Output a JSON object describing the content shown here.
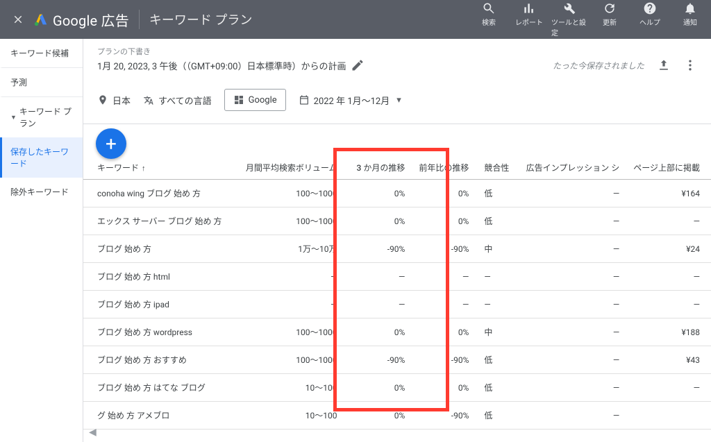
{
  "header": {
    "brand": "Google 広告",
    "page_title": "キーワード プラン",
    "tools": {
      "search": "検索",
      "reports": "レポート",
      "tools": "ツールと設定",
      "refresh": "更新",
      "help": "ヘルプ",
      "notif": "通知"
    }
  },
  "sidebar": {
    "ideas": "キーワード候補",
    "forecast": "予測",
    "plan": "キーワード プラン",
    "saved": "保存したキーワード",
    "negative": "除外キーワード"
  },
  "plan": {
    "draft_label": "プランの下書き",
    "date_line": "1月 20, 2023, 3 午後（（GMT+09:00）日本標準時）からの計画",
    "saved_msg": "たった今保存されました"
  },
  "filters": {
    "location": "日本",
    "language": "すべての言語",
    "network": "Google",
    "daterange": "2022 年 1月～12月"
  },
  "table": {
    "headers": {
      "keyword": "キーワード",
      "volume": "月間平均検索ボリューム",
      "trend3m": "3 か月の推移",
      "trendyoy": "前年比の推移",
      "competition": "競合性",
      "impression": "広告インプレッション シ",
      "topbid": "ページ上部に掲載"
    },
    "rows": [
      {
        "kw": "conoha wing ブログ 始め 方",
        "vol": "100～1000",
        "t3": "0%",
        "ty": "0%",
        "comp": "低",
        "imp": "—",
        "bid": "¥164"
      },
      {
        "kw": "エックス サーバー ブログ 始め 方",
        "vol": "100～1000",
        "t3": "0%",
        "ty": "0%",
        "comp": "低",
        "imp": "—",
        "bid": "—"
      },
      {
        "kw": "ブログ 始め 方",
        "vol": "1万～10万",
        "t3": "-90%",
        "ty": "-90%",
        "comp": "中",
        "imp": "—",
        "bid": "¥24"
      },
      {
        "kw": "ブログ 始め 方 html",
        "vol": "—",
        "t3": "—",
        "ty": "—",
        "comp": "—",
        "imp": "—",
        "bid": "—"
      },
      {
        "kw": "ブログ 始め 方 ipad",
        "vol": "—",
        "t3": "—",
        "ty": "—",
        "comp": "—",
        "imp": "—",
        "bid": "—"
      },
      {
        "kw": "ブログ 始め 方 wordpress",
        "vol": "100～1000",
        "t3": "0%",
        "ty": "0%",
        "comp": "中",
        "imp": "—",
        "bid": "¥188"
      },
      {
        "kw": "ブログ 始め 方 おすすめ",
        "vol": "100～1000",
        "t3": "-90%",
        "ty": "-90%",
        "comp": "低",
        "imp": "—",
        "bid": "¥43"
      },
      {
        "kw": "ブログ 始め 方 はてな ブログ",
        "vol": "10～100",
        "t3": "0%",
        "ty": "0%",
        "comp": "低",
        "imp": "—",
        "bid": "—"
      },
      {
        "kw": "グ 始め 方 アメブロ",
        "vol": "10～100",
        "t3": "0%",
        "ty": "-90%",
        "comp": "低",
        "imp": "—",
        "bid": ""
      }
    ]
  }
}
